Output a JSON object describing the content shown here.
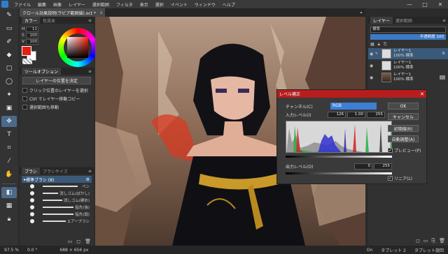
{
  "menubar": {
    "items": [
      "ファイル",
      "編集",
      "画像",
      "レイヤー",
      "選択範囲",
      "フィルタ",
      "表示",
      "選択",
      "イベント",
      "ウィンドウ",
      "ヘルプ"
    ],
    "minimize": "—",
    "maximize": "□",
    "close": "✕"
  },
  "document_tab": {
    "title": "クロール効果説明(ラピア範囲値).oct *",
    "close": "x",
    "menu": "▾"
  },
  "color_panel": {
    "tabs": [
      "カラー",
      "色見本"
    ],
    "h_label": "H",
    "h_value": "11",
    "s_label": "S",
    "s_value": "100",
    "v_label": "V",
    "v_value": "100",
    "fg_color": "#e02010",
    "bg_color": "#ffffff"
  },
  "tool_options": {
    "title": "ツールオプション",
    "align_button": "レイヤーの位置を決定",
    "options": [
      "クリック位置のレイヤーを選択",
      "Ctrl でレイヤー移動コピー",
      "選択範囲も移動"
    ]
  },
  "brush_panel": {
    "tabs": [
      "ブラシ",
      "ブラシサイズ"
    ],
    "set_name": "標準ブラシ (8)",
    "brushes": [
      "ペン",
      "消しゴム(ぼかし)",
      "消しゴム(硬め)",
      "指先(強)",
      "指先(弱)",
      "エアーブラシ"
    ]
  },
  "layer_panel": {
    "tabs": [
      "レイヤー",
      "選択範囲"
    ],
    "blend_mode": "標準",
    "opacity_text": "不透明度",
    "opacity": 100,
    "layers": [
      {
        "name": "レイヤー1",
        "info": "100% 標準",
        "selected": true
      },
      {
        "name": "レイヤー1",
        "info": "100% 標準",
        "selected": false
      },
      {
        "name": "レイヤー1",
        "info": "100% 標準",
        "selected": false
      }
    ]
  },
  "levels_dialog": {
    "title": "レベル補正",
    "channel_label": "チャンネル(C)",
    "channel_value": "RGB",
    "input_label": "入力レベル(I)",
    "input_black": "126",
    "input_gamma": "1.00",
    "input_white": "255",
    "output_label": "出力レベル(O)",
    "output_black": "0",
    "output_white": "255",
    "ok": "OK",
    "cancel": "キャンセル",
    "reset": "初期値(R)",
    "auto": "自動調整(A)",
    "preview": "プレビュー(P)",
    "linear": "リニア(L)"
  },
  "statusbar": {
    "zoom": "97.5 %",
    "angle": "0.0 °",
    "size": "688 × 656 px",
    "tablet_state": "On",
    "tablet_name": "タブレット 2",
    "tablet_rotation": "タブレット旋回"
  }
}
